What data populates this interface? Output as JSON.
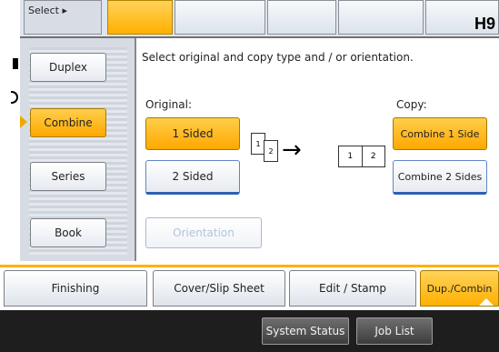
{
  "top": {
    "left_tab_label": "Select",
    "page_label": "H9"
  },
  "left_menu": {
    "items": [
      {
        "label": "Duplex",
        "selected": false
      },
      {
        "label": "Combine",
        "selected": true
      },
      {
        "label": "Series",
        "selected": false
      },
      {
        "label": "Book",
        "selected": false
      }
    ]
  },
  "main": {
    "instruction": "Select original and copy type and / or orientation.",
    "original_label": "Original:",
    "original_options": [
      {
        "label": "1 Sided",
        "selected": true
      },
      {
        "label": "2 Sided",
        "selected": false
      }
    ],
    "copy_label": "Copy:",
    "copy_options": [
      {
        "label": "Combine 1 Side",
        "selected": true
      },
      {
        "label": "Combine 2 Sides",
        "selected": false
      }
    ],
    "orientation_label": "Orientation",
    "diagram": {
      "page1": "1",
      "page2": "2",
      "arrow": "→"
    }
  },
  "bottom_tabs": [
    {
      "label": "Finishing",
      "selected": false
    },
    {
      "label": "Cover/Slip Sheet",
      "selected": false
    },
    {
      "label": "Edit / Stamp",
      "selected": false
    },
    {
      "label": "Dup./Combin",
      "selected": true
    }
  ],
  "status_bar": {
    "system_status": "System Status",
    "job_list": "Job List"
  },
  "colors": {
    "accent": "#ffb000",
    "panel": "#d7dce4",
    "status_bar": "#1e1e1e"
  }
}
